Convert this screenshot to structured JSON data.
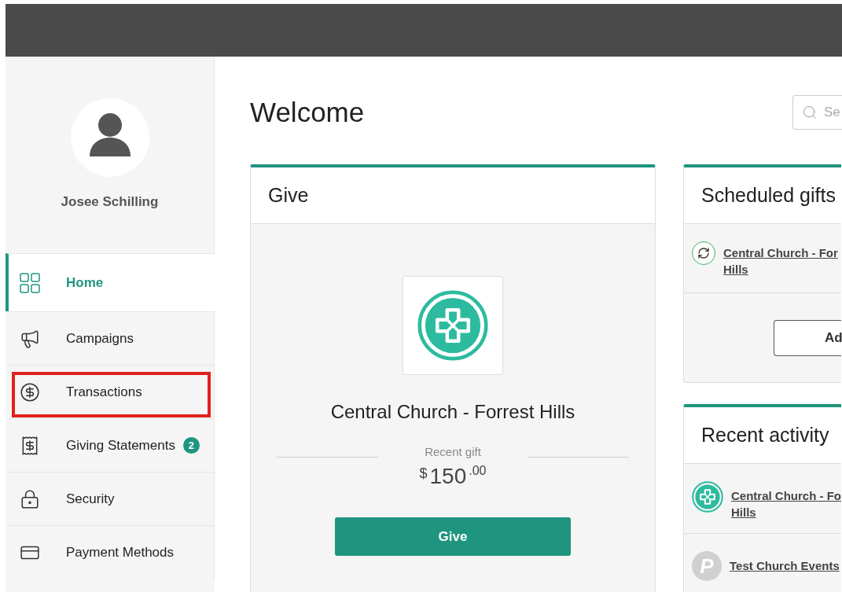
{
  "profile": {
    "name": "Josee Schilling"
  },
  "nav": [
    {
      "label": "Home",
      "kind": "grid",
      "selected": true,
      "highlighted": false
    },
    {
      "label": "Campaigns",
      "kind": "megaphone",
      "selected": false,
      "highlighted": false
    },
    {
      "label": "Transactions",
      "kind": "dollar",
      "selected": false,
      "highlighted": true
    },
    {
      "label": "Giving Statements",
      "kind": "receipt",
      "selected": false,
      "highlighted": false,
      "badge": "2"
    },
    {
      "label": "Security",
      "kind": "lock",
      "selected": false,
      "highlighted": false
    },
    {
      "label": "Payment Methods",
      "kind": "card",
      "selected": false,
      "highlighted": false
    }
  ],
  "title": "Welcome",
  "search": {
    "placeholder": "Se"
  },
  "give_card": {
    "title": "Give",
    "church": "Central Church - Forrest Hills",
    "recent_label": "Recent gift",
    "currency": "$",
    "amount": "150",
    "cents": ".00",
    "button": "Give"
  },
  "scheduled": {
    "title": "Scheduled gifts",
    "items": [
      {
        "lines": [
          "Central Church - For",
          "Hills"
        ]
      }
    ],
    "button": "Ad"
  },
  "activity": {
    "title": "Recent activity",
    "items": [
      {
        "kind": "cross",
        "lines": [
          "Central Church - Fo",
          "Hills"
        ]
      },
      {
        "kind": "letter",
        "letter": "P",
        "lines": [
          "Test Church Events"
        ]
      }
    ]
  }
}
